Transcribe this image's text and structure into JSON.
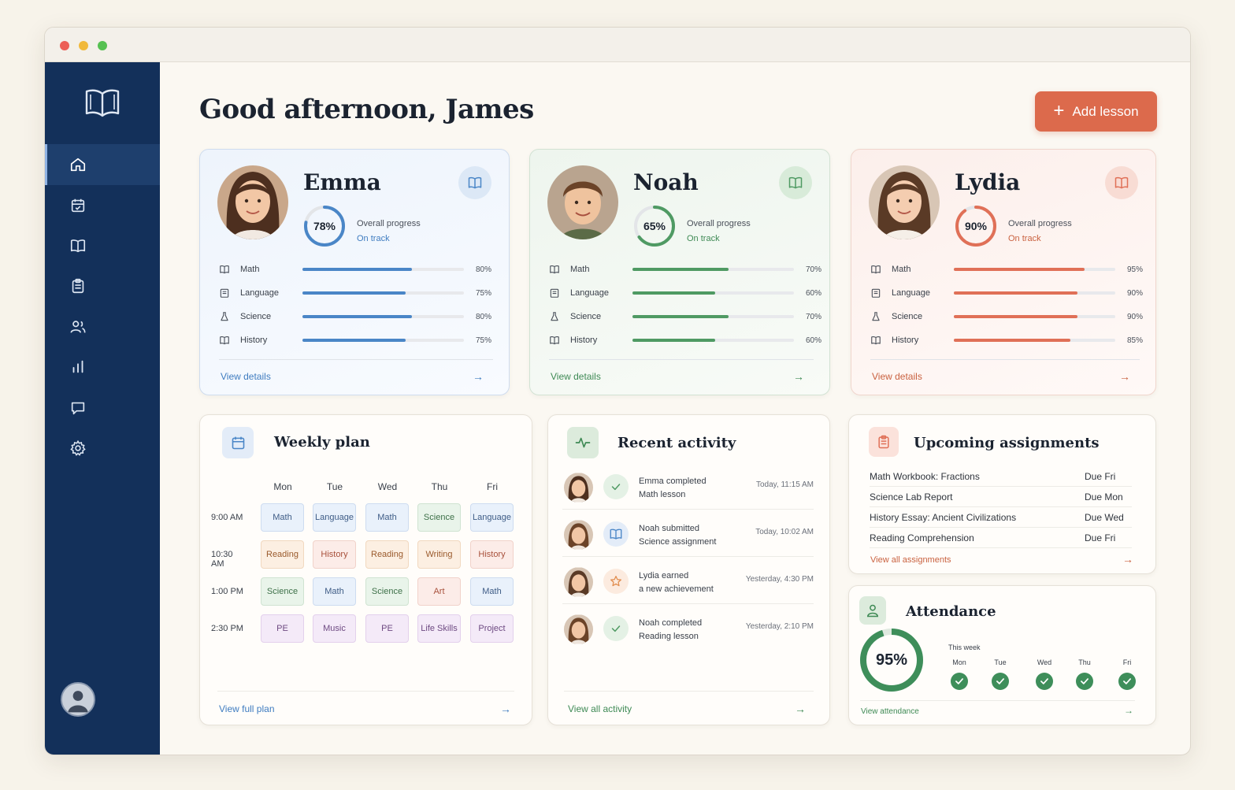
{
  "greeting": "Good afternoon, James",
  "add_button": {
    "label": "Add lesson"
  },
  "colors": {
    "sidebar": "#13305a",
    "accent": "#dc6a4c",
    "blue": "#4a86c7",
    "green": "#4f9a63",
    "red": "#e07057"
  },
  "sidebar": {
    "items": [
      {
        "name": "home",
        "icon": "home-icon",
        "active": true
      },
      {
        "name": "calendar",
        "icon": "calendar-icon"
      },
      {
        "name": "lessons",
        "icon": "book-icon"
      },
      {
        "name": "assignments",
        "icon": "clipboard-icon"
      },
      {
        "name": "students",
        "icon": "users-icon"
      },
      {
        "name": "reports",
        "icon": "bar-chart-icon"
      },
      {
        "name": "messages",
        "icon": "chat-icon"
      },
      {
        "name": "settings",
        "icon": "gear-icon"
      }
    ]
  },
  "students": [
    {
      "name": "Emma",
      "progress": 78,
      "progress_label": "78%",
      "overall_label": "Overall progress",
      "status": "On track",
      "subjects": [
        {
          "name": "Math",
          "value": 80,
          "label": "80%"
        },
        {
          "name": "Language",
          "value": 75,
          "label": "75%"
        },
        {
          "name": "Science",
          "value": 80,
          "label": "80%"
        },
        {
          "name": "History",
          "value": 75,
          "label": "75%"
        }
      ],
      "link": "View details"
    },
    {
      "name": "Noah",
      "progress": 65,
      "progress_label": "65%",
      "overall_label": "Overall progress",
      "status": "On track",
      "subjects": [
        {
          "name": "Math",
          "value": 70,
          "label": "70%"
        },
        {
          "name": "Language",
          "value": 60,
          "label": "60%"
        },
        {
          "name": "Science",
          "value": 70,
          "label": "70%"
        },
        {
          "name": "History",
          "value": 60,
          "label": "60%"
        }
      ],
      "link": "View details"
    },
    {
      "name": "Lydia",
      "progress": 90,
      "progress_label": "90%",
      "overall_label": "Overall progress",
      "status": "On track",
      "subjects": [
        {
          "name": "Math",
          "value": 95,
          "label": "95%"
        },
        {
          "name": "Language",
          "value": 90,
          "label": "90%"
        },
        {
          "name": "Science",
          "value": 90,
          "label": "90%"
        },
        {
          "name": "History",
          "value": 85,
          "label": "85%"
        }
      ],
      "link": "View details"
    }
  ],
  "weekly_plan": {
    "title": "Weekly plan",
    "days": [
      "Mon",
      "Tue",
      "Wed",
      "Thu",
      "Fri"
    ],
    "rows": [
      {
        "time": "9:00 AM",
        "cells": [
          "Math",
          "Language",
          "Math",
          "Science",
          "Language"
        ]
      },
      {
        "time": "10:30 AM",
        "cells": [
          "Reading",
          "History",
          "Reading",
          "Writing",
          "History"
        ]
      },
      {
        "time": "1:00 PM",
        "cells": [
          "Science",
          "Math",
          "Science",
          "Art",
          "Math"
        ]
      },
      {
        "time": "2:30 PM",
        "cells": [
          "PE",
          "Music",
          "PE",
          "Life Skills",
          "Project"
        ]
      }
    ],
    "link": "View full plan"
  },
  "recent_activity": {
    "title": "Recent activity",
    "items": [
      {
        "line1": "Emma completed",
        "line2": "Math lesson",
        "time": "Today, 11:15 AM",
        "badge": "check-icon"
      },
      {
        "line1": "Noah submitted",
        "line2": "Science assignment",
        "time": "Today, 10:02 AM",
        "badge": "book-icon"
      },
      {
        "line1": "Lydia earned",
        "line2": "a new achievement",
        "time": "Yesterday, 4:30 PM",
        "badge": "star-icon"
      },
      {
        "line1": "Noah completed",
        "line2": "Reading lesson",
        "time": "Yesterday, 2:10 PM",
        "badge": "check-icon"
      }
    ],
    "link": "View all activity"
  },
  "assignments": {
    "title": "Upcoming assignments",
    "items": [
      {
        "name": "Math Workbook: Fractions",
        "due": "Due Fri"
      },
      {
        "name": "Science Lab Report",
        "due": "Due Mon"
      },
      {
        "name": "History Essay: Ancient Civilizations",
        "due": "Due Wed"
      },
      {
        "name": "Reading Comprehension",
        "due": "Due Fri"
      }
    ],
    "link": "View all assignments"
  },
  "attendance": {
    "title": "Attendance",
    "value": 95,
    "label": "95%",
    "week_label": "This week",
    "days": [
      "Mon",
      "Tue",
      "Wed",
      "Thu",
      "Fri"
    ],
    "link": "View attendance"
  }
}
